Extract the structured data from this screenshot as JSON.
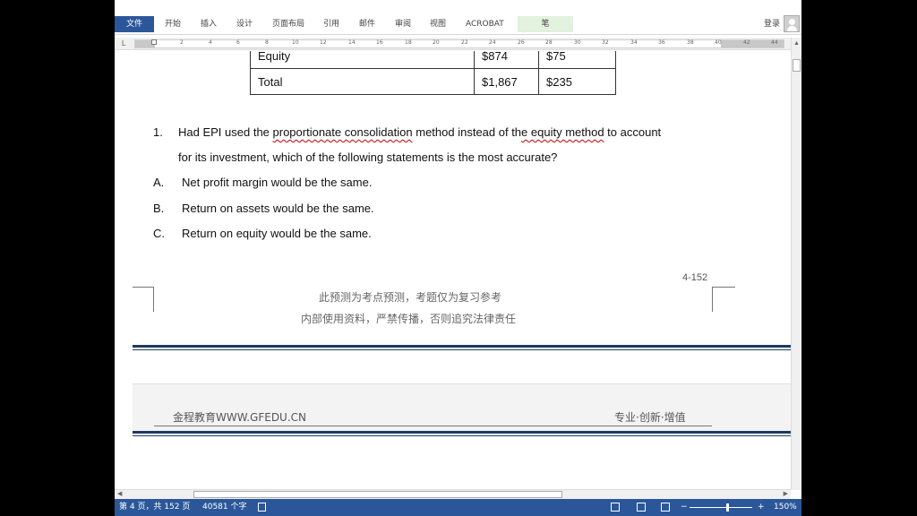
{
  "ribbon": {
    "tabs": [
      "文件",
      "开始",
      "插入",
      "设计",
      "页面布局",
      "引用",
      "邮件",
      "审阅",
      "视图",
      "ACROBAT",
      "笔"
    ],
    "login": "登录"
  },
  "ruler": {
    "numbers": [
      "2",
      "4",
      "6",
      "8",
      "10",
      "12",
      "14",
      "16",
      "18",
      "20",
      "22",
      "24",
      "26",
      "28",
      "30",
      "32",
      "34",
      "36",
      "38",
      "40",
      "42",
      "44"
    ]
  },
  "table": {
    "rows": [
      [
        "Equity",
        "$874",
        "$75"
      ],
      [
        "Total",
        "$1,867",
        "$235"
      ]
    ]
  },
  "question": {
    "number": "1.",
    "line1_a": "Had EPI used the ",
    "line1_b": "proportionate consolidation",
    "line1_c": " method instead of th",
    "line1_d": "e equity method",
    "line1_e": " to account",
    "line2": "for its investment, which of the following statements is the most accurate?",
    "options": [
      {
        "letter": "A.",
        "text": "Net profit margin would be the same."
      },
      {
        "letter": "B.",
        "text": "Return on assets would be the same."
      },
      {
        "letter": "C.",
        "text": "Return on equity would be the same."
      }
    ]
  },
  "page_number": "4-152",
  "footer": {
    "line1": "此预测为考点预测，考题仅为复习参考",
    "line2": "内部使用资料，严禁传播，否则追究法律责任"
  },
  "next_page_header": {
    "left": "金程教育WWW.GFEDU.CN",
    "right": "专业·创新·增值"
  },
  "status": {
    "page_info": "第 4 页，共 152 页",
    "word_count": "40581 个字",
    "zoom": "150%"
  },
  "colors": {
    "accent": "#2b579a",
    "spell_underline": "#cc0000",
    "rule": "#1f3a5f"
  }
}
